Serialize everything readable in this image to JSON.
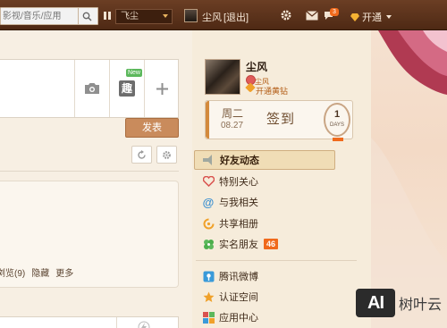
{
  "topbar": {
    "search_placeholder": "影视/音乐/应用",
    "music_select": "飞尘",
    "user_name": "尘风",
    "logout_label": "[退出]",
    "notification_count": "3",
    "vip_label": "开通",
    "icons": [
      "search-icon",
      "pause-icon",
      "gear-icon",
      "mail-icon",
      "notification-icon",
      "diamond-icon"
    ]
  },
  "composer": {
    "tools": [
      "camera-icon",
      "qu-app-icon",
      "plus-icon"
    ],
    "new_tag": "New",
    "post_label": "发表"
  },
  "feed": {
    "actions": [
      "浏览(9)",
      "隐藏",
      "更多"
    ]
  },
  "profile": {
    "name": "尘风",
    "vip_line1": "尘风",
    "vip_line2": "开通黄钻"
  },
  "signin": {
    "weekday": "周二",
    "date": "08.27",
    "button": "签到",
    "days": "1",
    "days_unit": "DAYS"
  },
  "nav": {
    "items": [
      {
        "label": "好友动态",
        "icon": "friends-feed-icon"
      },
      {
        "label": "特别关心",
        "icon": "heart-icon"
      },
      {
        "label": "与我相关",
        "icon": "at-icon"
      },
      {
        "label": "共享相册",
        "icon": "shared-album-icon"
      },
      {
        "label": "实名朋友",
        "icon": "clover-icon",
        "badge": "46"
      },
      {
        "label": "腾讯微博",
        "icon": "weibo-icon"
      },
      {
        "label": "认证空间",
        "icon": "star-icon"
      },
      {
        "label": "应用中心",
        "icon": "app-center-icon"
      }
    ]
  },
  "watermark": {
    "box": "AI",
    "text": "树叶云"
  },
  "colors": {
    "topbar": "#5a3019",
    "accent": "#f06a1c",
    "post_button": "#c98b5c",
    "active_nav": "#f0ddb6"
  }
}
